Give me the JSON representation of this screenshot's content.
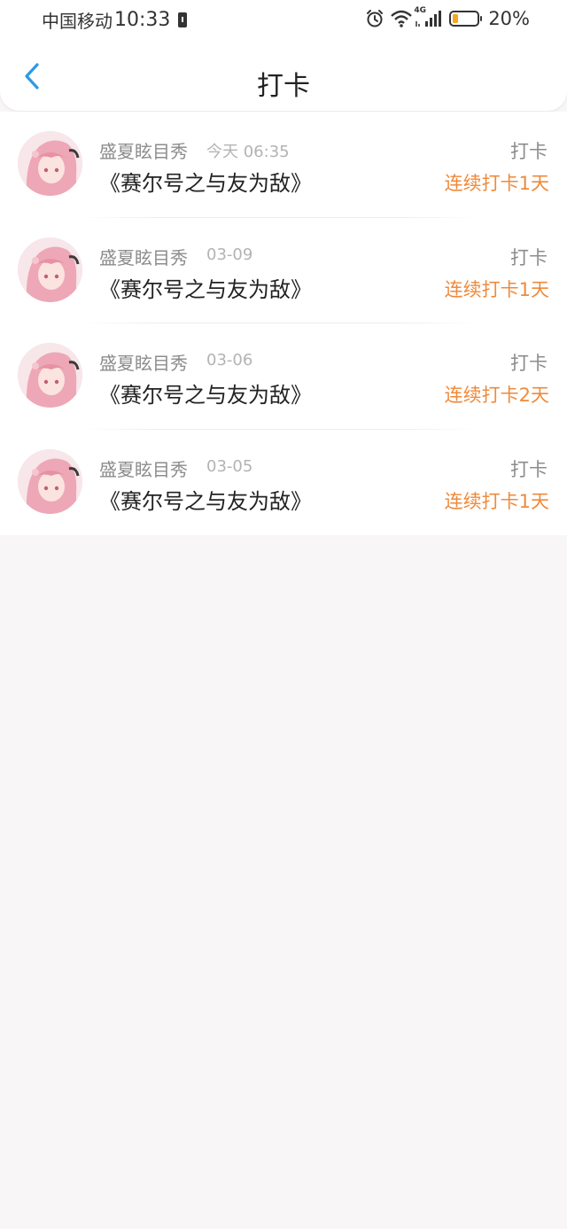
{
  "status_bar": {
    "carrier": "中国移动",
    "time": "10:33",
    "network": "4G",
    "battery_percent": "20%",
    "icons": [
      "battery-saver-icon",
      "alarm-icon",
      "wifi-icon",
      "signal-icon",
      "battery-icon"
    ]
  },
  "nav": {
    "back_icon": "chevron-left-icon",
    "title": "打卡"
  },
  "colors": {
    "accent_back": "#2a9ae6",
    "streak": "#ef8a3b",
    "muted": "#8c8c8c",
    "background": "#f8f6f7"
  },
  "items": [
    {
      "username": "盛夏眩目秀",
      "time": "今天 06:35",
      "title": "《赛尔号之与友为敌》",
      "action": "打卡",
      "streak": "连续打卡1天"
    },
    {
      "username": "盛夏眩目秀",
      "time": "03-09",
      "title": "《赛尔号之与友为敌》",
      "action": "打卡",
      "streak": "连续打卡1天"
    },
    {
      "username": "盛夏眩目秀",
      "time": "03-06",
      "title": "《赛尔号之与友为敌》",
      "action": "打卡",
      "streak": "连续打卡2天"
    },
    {
      "username": "盛夏眩目秀",
      "time": "03-05",
      "title": "《赛尔号之与友为敌》",
      "action": "打卡",
      "streak": "连续打卡1天"
    }
  ]
}
